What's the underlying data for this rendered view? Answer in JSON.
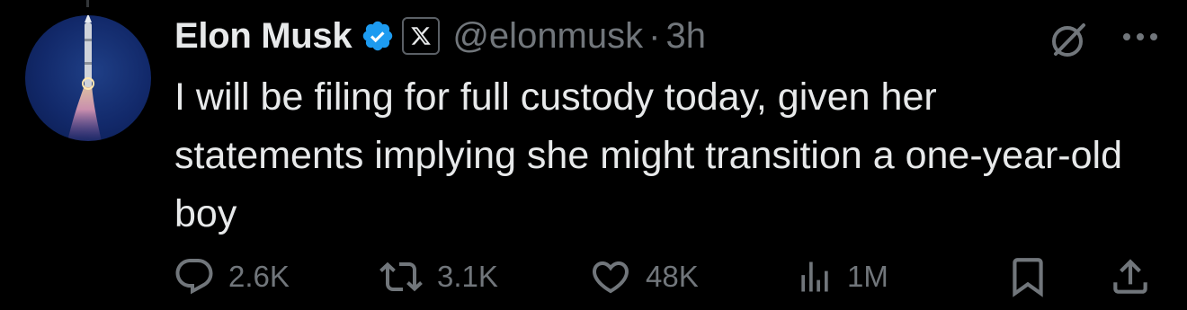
{
  "author": {
    "name": "Elon Musk",
    "handle": "@elonmusk",
    "time": "3h",
    "separator": "·",
    "verified_color": "#1d9bf0",
    "avatar_icon": "rocket-launch-avatar",
    "affiliate_badge_icon": "x-logo-icon"
  },
  "tweet": {
    "text": "I will be filing for full custody today, given her statements implying she might transition a one-year-old boy"
  },
  "actions": {
    "replies": {
      "icon": "reply-icon",
      "count": "2.6K"
    },
    "reposts": {
      "icon": "repost-icon",
      "count": "3.1K"
    },
    "likes": {
      "icon": "like-icon",
      "count": "48K"
    },
    "views": {
      "icon": "views-icon",
      "count": "1M"
    },
    "bookmark": {
      "icon": "bookmark-icon"
    },
    "share": {
      "icon": "share-icon"
    }
  },
  "header_icons": {
    "grok": "grok-icon",
    "more": "more-icon"
  },
  "colors": {
    "background": "#000000",
    "text_primary": "#e7e9ea",
    "text_secondary": "#71767b",
    "accent": "#1d9bf0"
  }
}
